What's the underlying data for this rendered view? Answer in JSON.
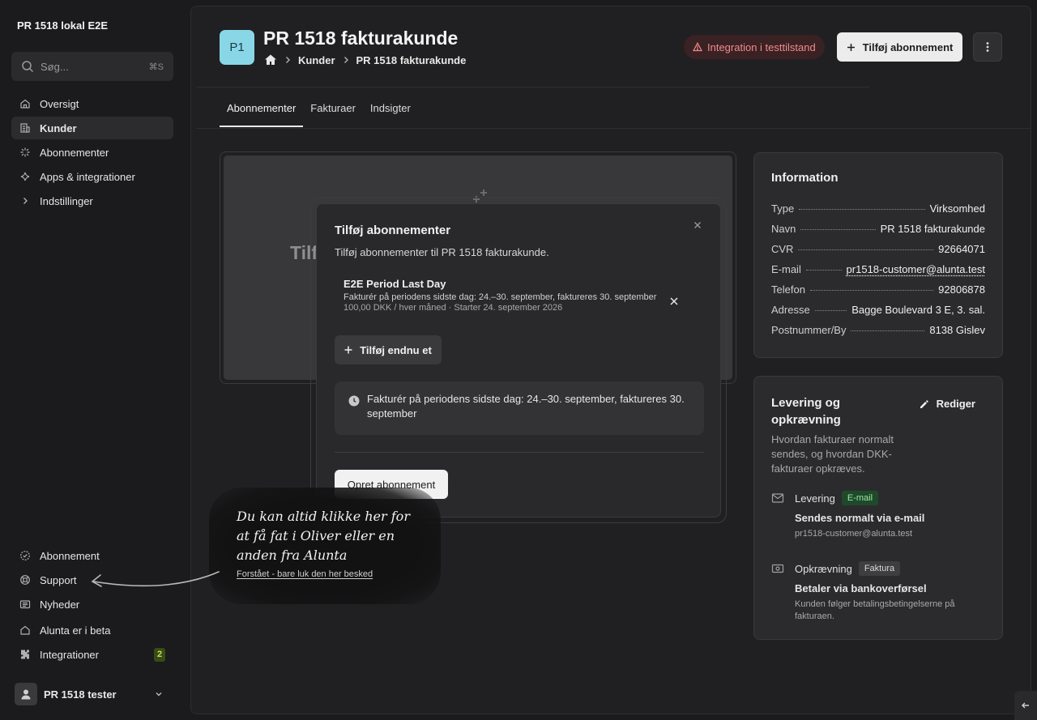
{
  "sidebar": {
    "org_name": "PR 1518 lokal E2E",
    "search": {
      "placeholder": "Søg...",
      "shortcut": "⌘S"
    },
    "items": [
      {
        "label": "Oversigt",
        "icon": "home-icon"
      },
      {
        "label": "Kunder",
        "icon": "building-icon",
        "active": true
      },
      {
        "label": "Abonnementer",
        "icon": "sparkle-icon"
      },
      {
        "label": "Apps & integrationer",
        "icon": "sparkle-icon"
      },
      {
        "label": "Indstillinger",
        "icon": "chevron-right-icon"
      }
    ],
    "bottom_items": [
      {
        "label": "Abonnement",
        "icon": "circle-check-icon"
      },
      {
        "label": "Support",
        "icon": "lifebuoy-icon"
      },
      {
        "label": "Nyheder",
        "icon": "newspaper-icon"
      },
      {
        "label": "Alunta er i beta",
        "icon": "house-beta-icon"
      },
      {
        "label": "Integrationer",
        "icon": "puzzle-icon",
        "count": "2"
      }
    ],
    "user_name": "PR 1518 tester"
  },
  "header": {
    "avatar_initials": "P1",
    "title": "PR 1518 fakturakunde",
    "breadcrumb": [
      "Kunder",
      "PR 1518 fakturakunde"
    ],
    "warning": "Integration i testtilstand",
    "add_button": "Tilføj abonnement"
  },
  "tabs": [
    "Abonnementer",
    "Fakturaer",
    "Indsigter"
  ],
  "empty_state": {
    "title": "Tilf"
  },
  "information": {
    "title": "Information",
    "rows": [
      {
        "key": "Type",
        "value": "Virksomhed"
      },
      {
        "key": "Navn",
        "value": "PR 1518 fakturakunde"
      },
      {
        "key": "CVR",
        "value": "92664071"
      },
      {
        "key": "E-mail",
        "value": "pr1518-customer@alunta.test"
      },
      {
        "key": "Telefon",
        "value": "92806878"
      },
      {
        "key": "Adresse",
        "value": "Bagge Boulevard 3 E, 3. sal."
      },
      {
        "key": "Postnummer/By",
        "value": "8138 Gislev"
      }
    ]
  },
  "delivery": {
    "title": "Levering og opkrævning",
    "edit": "Rediger",
    "description": "Hvordan fakturaer normalt sendes, og hvordan DKK-fakturaer opkræves.",
    "levering": {
      "label": "Levering",
      "tag": "E-mail",
      "main": "Sendes normalt via e-mail",
      "sub": "pr1518-customer@alunta.test"
    },
    "opkraevning": {
      "label": "Opkrævning",
      "tag": "Faktura",
      "main": "Betaler via bankoverførsel",
      "sub": "Kunden følger betalingsbetingelserne på fakturaen."
    }
  },
  "dialog": {
    "title": "Tilføj abonnementer",
    "subtitle": "Tilføj abonnementer til PR 1518 fakturakunde.",
    "subscription": {
      "name": "E2E Period Last Day",
      "desc": "Fakturér på periodens sidste dag: 24.–30. september, faktureres 30. september",
      "price": "100,00 DKK / hver måned · Starter 24. september 2026"
    },
    "add_more": "Tilføj endnu et",
    "note": "Fakturér på periodens sidste dag: 24.–30. september, faktureres 30. september",
    "create": "Opret abonnement"
  },
  "help": {
    "text": "Du kan altid klikke her for at få fat i Oliver eller en anden fra Alunta",
    "dismiss": "Forstået - bare luk den her besked"
  }
}
